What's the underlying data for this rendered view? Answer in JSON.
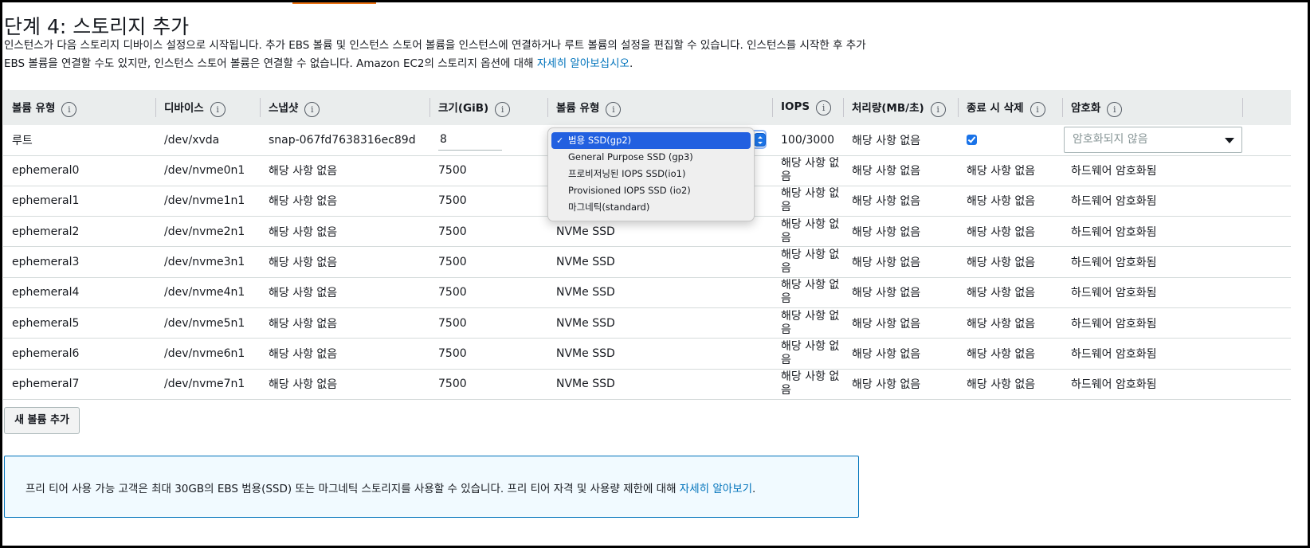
{
  "page": {
    "title": "단계 4: 스토리지 추가",
    "intro_text": "인스턴스가 다음 스토리지 디바이스 설정으로 시작됩니다. 추가 EBS 볼륨 및 인스턴스 스토어 볼륨을 인스턴스에 연결하거나 루트 볼륨의 설정을 편집할 수 있습니다. 인스턴스를 시작한 후 추가 EBS 볼륨을 연결할 수도 있지만, 인스턴스 스토어 볼륨은 연결할 수 없습니다. Amazon EC2의 스토리지 옵션에 대해",
    "intro_link": "자세히 알아보십시오",
    "intro_end": "."
  },
  "table": {
    "headers": [
      "볼륨 유형",
      "디바이스",
      "스냅샷",
      "크기(GiB)",
      "볼륨 유형",
      "IOPS",
      "처리량(MB/초)",
      "종료 시 삭제",
      "암호화"
    ],
    "info_icon": "i",
    "root_row": {
      "type": "루트",
      "device": "/dev/xvda",
      "snapshot": "snap-067fd7638316ec89d",
      "size": "8",
      "iops": "100/3000",
      "throughput": "해당 사항 없음",
      "delete_on_termination": true,
      "encryption_placeholder": "암호화되지 않음"
    },
    "rows": [
      {
        "type": "ephemeral0",
        "device": "/dev/nvme0n1",
        "snapshot": "해당 사항 없음",
        "size": "7500",
        "volume_type": "",
        "iops": "해당 사항 없음",
        "throughput": "해당 사항 없음",
        "delete": "해당 사항 없음",
        "encryption": "하드웨어 암호화됨"
      },
      {
        "type": "ephemeral1",
        "device": "/dev/nvme1n1",
        "snapshot": "해당 사항 없음",
        "size": "7500",
        "volume_type": "",
        "iops": "해당 사항 없음",
        "throughput": "해당 사항 없음",
        "delete": "해당 사항 없음",
        "encryption": "하드웨어 암호화됨"
      },
      {
        "type": "ephemeral2",
        "device": "/dev/nvme2n1",
        "snapshot": "해당 사항 없음",
        "size": "7500",
        "volume_type": "NVMe SSD",
        "iops": "해당 사항 없음",
        "throughput": "해당 사항 없음",
        "delete": "해당 사항 없음",
        "encryption": "하드웨어 암호화됨"
      },
      {
        "type": "ephemeral3",
        "device": "/dev/nvme3n1",
        "snapshot": "해당 사항 없음",
        "size": "7500",
        "volume_type": "NVMe SSD",
        "iops": "해당 사항 없음",
        "throughput": "해당 사항 없음",
        "delete": "해당 사항 없음",
        "encryption": "하드웨어 암호화됨"
      },
      {
        "type": "ephemeral4",
        "device": "/dev/nvme4n1",
        "snapshot": "해당 사항 없음",
        "size": "7500",
        "volume_type": "NVMe SSD",
        "iops": "해당 사항 없음",
        "throughput": "해당 사항 없음",
        "delete": "해당 사항 없음",
        "encryption": "하드웨어 암호화됨"
      },
      {
        "type": "ephemeral5",
        "device": "/dev/nvme5n1",
        "snapshot": "해당 사항 없음",
        "size": "7500",
        "volume_type": "NVMe SSD",
        "iops": "해당 사항 없음",
        "throughput": "해당 사항 없음",
        "delete": "해당 사항 없음",
        "encryption": "하드웨어 암호화됨"
      },
      {
        "type": "ephemeral6",
        "device": "/dev/nvme6n1",
        "snapshot": "해당 사항 없음",
        "size": "7500",
        "volume_type": "NVMe SSD",
        "iops": "해당 사항 없음",
        "throughput": "해당 사항 없음",
        "delete": "해당 사항 없음",
        "encryption": "하드웨어 암호화됨"
      },
      {
        "type": "ephemeral7",
        "device": "/dev/nvme7n1",
        "snapshot": "해당 사항 없음",
        "size": "7500",
        "volume_type": "NVMe SSD",
        "iops": "해당 사항 없음",
        "throughput": "해당 사항 없음",
        "delete": "해당 사항 없음",
        "encryption": "하드웨어 암호화됨"
      }
    ]
  },
  "volume_type_dropdown": {
    "selected_check": "✓",
    "options": [
      "범용 SSD(gp2)",
      "General Purpose SSD (gp3)",
      "프로비저닝된 IOPS SSD(io1)",
      "Provisioned IOPS SSD (io2)",
      "마그네틱(standard)"
    ],
    "selected_index": 0
  },
  "add_volume_button": "새 볼륨 추가",
  "free_tier": {
    "text": "프리 티어 사용 가능 고객은 최대 30GB의 EBS 범용(SSD) 또는 마그네틱 스토리지를 사용할 수 있습니다. 프리 티어 자격 및 사용량 제한에 대해",
    "link": "자세히 알아보기",
    "end": "."
  },
  "colors": {
    "link": "#0073bb",
    "header_bg": "#eaeded",
    "dropdown_selected": "#2260e0",
    "info_box_border": "#0073bb",
    "info_box_bg": "#f1faff",
    "accent": "#ec7211"
  },
  "icons": {
    "info": "info-circle-icon",
    "caret": "caret-down-icon",
    "checkbox": "checkbox-checked-icon",
    "select_stepper": "select-stepper-icon"
  }
}
